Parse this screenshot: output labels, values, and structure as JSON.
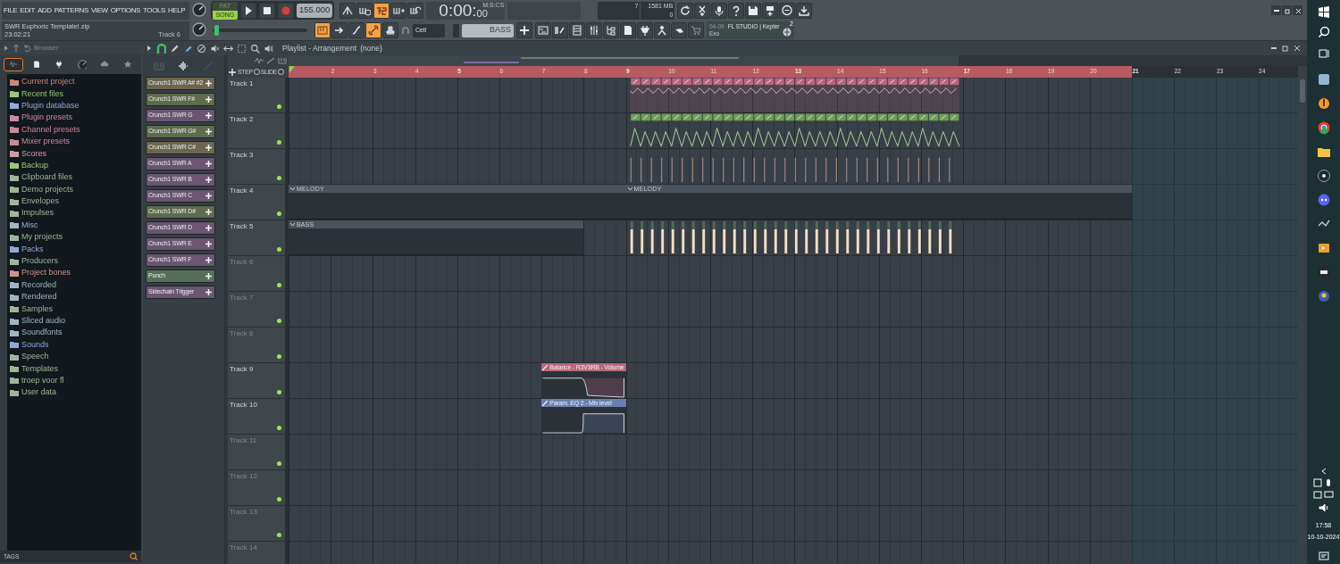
{
  "menu": [
    "FILE",
    "EDIT",
    "ADD",
    "PATTERNS",
    "VIEW",
    "OPTIONS",
    "TOOLS",
    "HELP"
  ],
  "project": {
    "file": "SWR Euphoric Template!.zip",
    "time": "23:02:21",
    "track": "Track 6"
  },
  "mode": [
    {
      "label": "PAT",
      "selected": false
    },
    {
      "label": "SONG",
      "selected": true
    }
  ],
  "tempo": "155.000",
  "pitch": {
    "level": 0.02
  },
  "toolbar_row1": [
    {
      "on": false
    },
    {
      "on": false
    },
    {
      "on": true
    },
    {
      "on": false
    },
    {
      "on": false
    }
  ],
  "clock": {
    "time": "0:00:",
    "centiseconds": "00",
    "unit": "M:S:CS"
  },
  "monitor": {
    "polyphony": "7",
    "memory": "1581 MB",
    "cpu": "0"
  },
  "toolbar_row2": [
    {
      "on": true
    },
    {
      "on": false
    },
    {
      "on": false
    },
    {
      "on": true
    },
    {
      "on": false
    }
  ],
  "snap": "Cell",
  "pattern": "BASS",
  "news": {
    "date": "04-09",
    "title": "FL STUDIO | Kepler",
    "subtitle": "Exo",
    "badge": "2"
  },
  "browser": {
    "title": "Browser",
    "tabs": [
      {
        "selected": true
      },
      {
        "selected": false
      },
      {
        "selected": false
      },
      {
        "selected": false
      },
      {
        "selected": false
      },
      {
        "selected": false
      }
    ],
    "items": [
      {
        "name": "Current project",
        "color": "#c98a78"
      },
      {
        "name": "Recent files",
        "color": "#9cc47a"
      },
      {
        "name": "Plugin database",
        "color": "#8ea8d8"
      },
      {
        "name": "Plugin presets",
        "color": "#c98aa8"
      },
      {
        "name": "Channel presets",
        "color": "#c98a98"
      },
      {
        "name": "Mixer presets",
        "color": "#c98aa0"
      },
      {
        "name": "Scores",
        "color": "#c9a0a0"
      },
      {
        "name": "Backup",
        "color": "#9cc47a"
      },
      {
        "name": "Clipboard files",
        "color": "#9fb59a"
      },
      {
        "name": "Demo projects",
        "color": "#9fb59a"
      },
      {
        "name": "Envelopes",
        "color": "#9fb59a"
      },
      {
        "name": "Impulses",
        "color": "#9fb59a"
      },
      {
        "name": "Misc",
        "color": "#a0b4c0"
      },
      {
        "name": "My projects",
        "color": "#9fb59a"
      },
      {
        "name": "Packs",
        "color": "#8ea8d8"
      },
      {
        "name": "Producers",
        "color": "#9fb59a"
      },
      {
        "name": "Project bones",
        "color": "#c9948a"
      },
      {
        "name": "Recorded",
        "color": "#a0b4c0"
      },
      {
        "name": "Rendered",
        "color": "#a0b4c0"
      },
      {
        "name": "Samples",
        "color": "#9fb59a"
      },
      {
        "name": "Sliced audio",
        "color": "#a0b4c0"
      },
      {
        "name": "Soundfonts",
        "color": "#a0b4c0"
      },
      {
        "name": "Sounds",
        "color": "#8ea8d8"
      },
      {
        "name": "Speech",
        "color": "#9fb59a"
      },
      {
        "name": "Templates",
        "color": "#9fb59a"
      },
      {
        "name": "troep voor fl",
        "color": "#9fb59a"
      },
      {
        "name": "User data",
        "color": "#9fb59a"
      }
    ],
    "footer": "TAGS"
  },
  "playlist": {
    "title": "Playlist - Arrangement",
    "pattern": "(none)",
    "step_label": "STEP",
    "slide_label": "SLIDE",
    "channels": [
      {
        "name": "Crunch1 SWR A# #2",
        "color": "#6c6650"
      },
      {
        "name": "Crunch1 SWR F#",
        "color": "#5f6a4e"
      },
      {
        "name": "Crunch1 SWR G",
        "color": "#6a5670"
      },
      {
        "name": "Crunch1 SWR G#",
        "color": "#5f6a4e"
      },
      {
        "name": "Crunch1 SWR C#",
        "color": "#6c6650"
      },
      {
        "name": "Crunch1 SWR A",
        "color": "#6a5670"
      },
      {
        "name": "Crunch1 SWR B",
        "color": "#6a5670"
      },
      {
        "name": "Crunch1 SWR C",
        "color": "#6a5670"
      },
      {
        "name": "Crunch1 SWR D#",
        "color": "#5f6a4e"
      },
      {
        "name": "Crunch1 SWR D",
        "color": "#6a5670"
      },
      {
        "name": "Crunch1 SWR E",
        "color": "#6a5670"
      },
      {
        "name": "Crunch1 SWR F",
        "color": "#6a5670"
      },
      {
        "name": "Punch",
        "color": "#55705a"
      },
      {
        "name": "Sidechain Trigger",
        "color": "#6a5670"
      }
    ],
    "ruler": [
      "2",
      "3",
      "4",
      "5",
      "6",
      "7",
      "8",
      "9",
      "10",
      "11",
      "12",
      "13",
      "14",
      "15",
      "16",
      "17",
      "18",
      "19",
      "20",
      "21",
      "22",
      "23",
      "24"
    ],
    "tracks": [
      {
        "name": "Track 1",
        "empty": false
      },
      {
        "name": "Track 2",
        "empty": false
      },
      {
        "name": "Track 3",
        "empty": false
      },
      {
        "name": "Track 4",
        "empty": false
      },
      {
        "name": "Track 5",
        "empty": false
      },
      {
        "name": "Track 6",
        "empty": true
      },
      {
        "name": "Track 7",
        "empty": true
      },
      {
        "name": "Track 8",
        "empty": true
      },
      {
        "name": "Track 9",
        "empty": false
      },
      {
        "name": "Track 10",
        "empty": false
      },
      {
        "name": "Track 11",
        "empty": true
      },
      {
        "name": "Track 12",
        "empty": true
      },
      {
        "name": "Track 13",
        "empty": true
      },
      {
        "name": "Track 14",
        "empty": true
      }
    ],
    "clips": [
      {
        "kind": "strip",
        "color": "#b8667e"
      },
      {
        "kind": "spikes",
        "color": "#6f9c55"
      },
      {
        "kind": "ticks"
      },
      {
        "kind": "pattern",
        "label": "MELODY"
      },
      {
        "kind": "pattern",
        "label": "MELODY"
      },
      {
        "kind": "pattern",
        "label": "BASS"
      },
      {
        "kind": "notes"
      },
      {
        "kind": "fadeout",
        "label": "Balance - R3V3RB - Volume",
        "color": "#b8667e"
      },
      {
        "kind": "fadein",
        "label": "Param. EQ 2 - Mix level",
        "color": "#6a7fb0"
      }
    ]
  },
  "taskbar": {
    "time": "17:58",
    "date": "10-10-2024"
  }
}
